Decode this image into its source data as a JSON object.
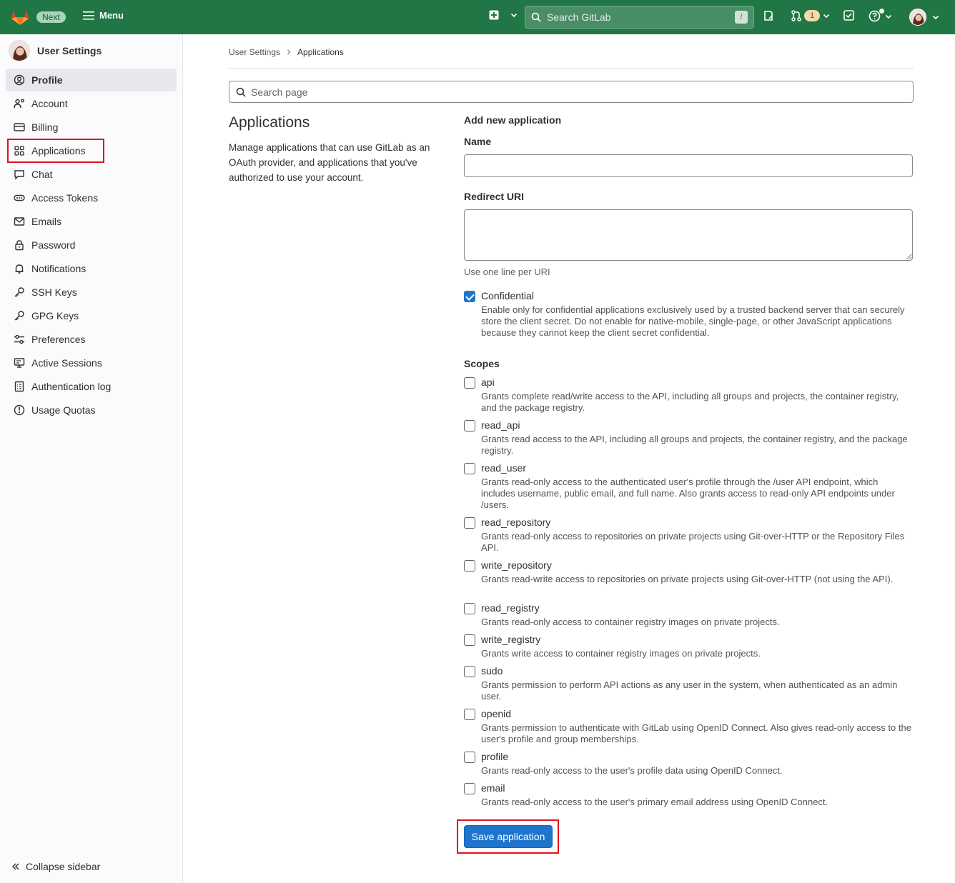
{
  "topbar": {
    "next_badge": "Next",
    "menu_label": "Menu",
    "search_placeholder": "Search GitLab",
    "search_shortcut": "/",
    "merge_requests_count": "1"
  },
  "sidebar": {
    "title": "User Settings",
    "items": [
      {
        "label": "Profile",
        "icon": "profile-icon"
      },
      {
        "label": "Account",
        "icon": "account-icon"
      },
      {
        "label": "Billing",
        "icon": "billing-icon"
      },
      {
        "label": "Applications",
        "icon": "applications-icon"
      },
      {
        "label": "Chat",
        "icon": "chat-icon"
      },
      {
        "label": "Access Tokens",
        "icon": "token-icon"
      },
      {
        "label": "Emails",
        "icon": "envelope-icon"
      },
      {
        "label": "Password",
        "icon": "lock-icon"
      },
      {
        "label": "Notifications",
        "icon": "bell-icon"
      },
      {
        "label": "SSH Keys",
        "icon": "key-icon"
      },
      {
        "label": "GPG Keys",
        "icon": "key-icon"
      },
      {
        "label": "Preferences",
        "icon": "preferences-icon"
      },
      {
        "label": "Active Sessions",
        "icon": "monitor-icon"
      },
      {
        "label": "Authentication log",
        "icon": "log-icon"
      },
      {
        "label": "Usage Quotas",
        "icon": "quota-icon"
      }
    ],
    "active_item": "Profile",
    "collapse_label": "Collapse sidebar"
  },
  "breadcrumb": {
    "parent": "User Settings",
    "current": "Applications"
  },
  "page_search_placeholder": "Search page",
  "section": {
    "title": "Applications",
    "description": "Manage applications that can use GitLab as an OAuth provider, and applications that you've authorized to use your account."
  },
  "form": {
    "heading": "Add new application",
    "name_label": "Name",
    "name_value": "",
    "redirect_label": "Redirect URI",
    "redirect_value": "",
    "redirect_help": "Use one line per URI",
    "confidential": {
      "label": "Confidential",
      "checked": true,
      "description": "Enable only for confidential applications exclusively used by a trusted backend server that can securely store the client secret. Do not enable for native-mobile, single-page, or other JavaScript applications because they cannot keep the client secret confidential."
    },
    "scopes_label": "Scopes",
    "scopes": [
      {
        "name": "api",
        "checked": false,
        "description": "Grants complete read/write access to the API, including all groups and projects, the container registry, and the package registry."
      },
      {
        "name": "read_api",
        "checked": false,
        "description": "Grants read access to the API, including all groups and projects, the container registry, and the package registry."
      },
      {
        "name": "read_user",
        "checked": false,
        "description": "Grants read-only access to the authenticated user's profile through the /user API endpoint, which includes username, public email, and full name. Also grants access to read-only API endpoints under /users."
      },
      {
        "name": "read_repository",
        "checked": false,
        "description": "Grants read-only access to repositories on private projects using Git-over-HTTP or the Repository Files API."
      },
      {
        "name": "write_repository",
        "checked": false,
        "description": "Grants read-write access to repositories on private projects using Git-over-HTTP (not using the API)."
      },
      {
        "name": "read_registry",
        "checked": false,
        "description": "Grants read-only access to container registry images on private projects."
      },
      {
        "name": "write_registry",
        "checked": false,
        "description": "Grants write access to container registry images on private projects."
      },
      {
        "name": "sudo",
        "checked": false,
        "description": "Grants permission to perform API actions as any user in the system, when authenticated as an admin user."
      },
      {
        "name": "openid",
        "checked": false,
        "description": "Grants permission to authenticate with GitLab using OpenID Connect. Also gives read-only access to the user's profile and group memberships."
      },
      {
        "name": "profile",
        "checked": false,
        "description": "Grants read-only access to the user's profile data using OpenID Connect."
      },
      {
        "name": "email",
        "checked": false,
        "description": "Grants read-only access to the user's primary email address using OpenID Connect."
      }
    ],
    "save_label": "Save application"
  },
  "colors": {
    "topbar": "#217645",
    "primary_button": "#1f75cb",
    "highlight": "#e0141e"
  }
}
